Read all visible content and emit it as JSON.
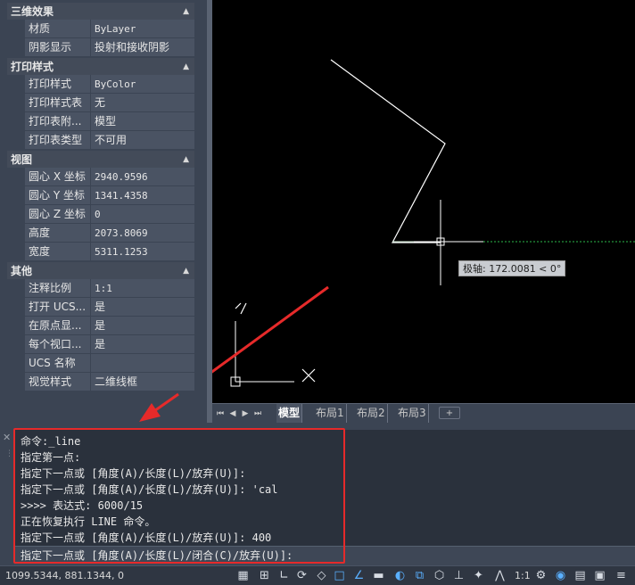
{
  "properties": {
    "sections": [
      {
        "title": "三维效果",
        "rows": [
          {
            "name": "材质",
            "value": "ByLayer"
          },
          {
            "name": "阴影显示",
            "value": "投射和接收阴影"
          }
        ]
      },
      {
        "title": "打印样式",
        "rows": [
          {
            "name": "打印样式",
            "value": "ByColor"
          },
          {
            "name": "打印样式表",
            "value": "无"
          },
          {
            "name": "打印表附...",
            "value": "模型"
          },
          {
            "name": "打印表类型",
            "value": "不可用"
          }
        ]
      },
      {
        "title": "视图",
        "rows": [
          {
            "name": "圆心 X 坐标",
            "value": "2940.9596"
          },
          {
            "name": "圆心 Y 坐标",
            "value": "1341.4358"
          },
          {
            "name": "圆心 Z 坐标",
            "value": "0"
          },
          {
            "name": "高度",
            "value": "2073.8069"
          },
          {
            "name": "宽度",
            "value": "5311.1253"
          }
        ]
      },
      {
        "title": "其他",
        "rows": [
          {
            "name": "注释比例",
            "value": "1:1"
          },
          {
            "name": "打开 UCS...",
            "value": "是"
          },
          {
            "name": "在原点显...",
            "value": "是"
          },
          {
            "name": "每个视口...",
            "value": "是"
          },
          {
            "name": "UCS 名称",
            "value": ""
          },
          {
            "name": "视觉样式",
            "value": "二维线框"
          }
        ]
      }
    ],
    "collapse_glyph": "▲"
  },
  "canvas": {
    "tooltip": "极轴: 172.0081 < 0°",
    "ucs_x_label": "X",
    "ucs_y_label": "Y"
  },
  "layout_tabs": {
    "nav": [
      "⏮",
      "◀",
      "▶",
      "⏭"
    ],
    "tabs": [
      "模型",
      "布局1",
      "布局2",
      "布局3"
    ],
    "active": "模型",
    "add_label": "+"
  },
  "command": {
    "history": [
      "命令:_line",
      "指定第一点:",
      "指定下一点或 [角度(A)/长度(L)/放弃(U)]:",
      "指定下一点或 [角度(A)/长度(L)/放弃(U)]: 'cal",
      ">>>> 表达式: 6000/15",
      "正在恢复执行 LINE 命令。",
      "指定下一点或 [角度(A)/长度(L)/放弃(U)]: 400"
    ],
    "prompt": "指定下一点或 [角度(A)/长度(L)/闭合(C)/放弃(U)]:",
    "close_glyph": "✕"
  },
  "status": {
    "coords": "1099.5344, 881.1344, 0",
    "scale": "1:1",
    "icons": [
      "grid-icon",
      "snap-icon",
      "ortho-icon",
      "polar-icon",
      "isodraft-icon",
      "osnap-icon",
      "otrack-icon",
      "lineweight-icon",
      "transparency-icon",
      "selection-cycling-icon",
      "3d-osnap-icon",
      "dynamic-ucs-icon",
      "annotation-visibility-icon",
      "annotation-scale-icon",
      "workspace-icon",
      "isolate-icon",
      "hardware-acceleration-icon",
      "clean-screen-icon",
      "customize-icon"
    ]
  },
  "colors": {
    "annotation_box": "#e62a2a",
    "polar_tracking": "#2db84a",
    "geometry": "#ffffff"
  }
}
